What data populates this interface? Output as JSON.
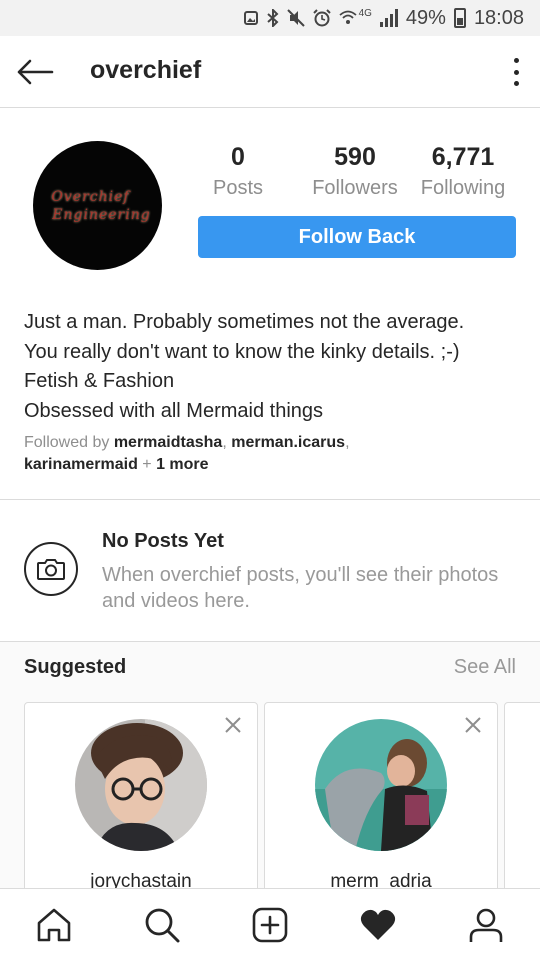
{
  "status_bar": {
    "network": "4G",
    "battery": "49%",
    "time": "18:08"
  },
  "header": {
    "back_icon": "arrow-left-icon",
    "username": "overchief",
    "menu_icon": "kebab-menu-icon"
  },
  "profile": {
    "avatar_text_line1": "Overchief",
    "avatar_text_line2": "Engineering",
    "stats": {
      "posts_count": "0",
      "posts_label": "Posts",
      "followers_count": "590",
      "followers_label": "Followers",
      "following_count": "6,771",
      "following_label": "Following"
    },
    "follow_button_label": "Follow Back",
    "bio_lines": [
      "Just a man. Probably sometimes not the average.",
      "You really don't want to know the kinky details. ;-)",
      "Fetish & Fashion",
      "Obsessed with all Mermaid things"
    ],
    "followed_by": {
      "prefix": "Followed by ",
      "user1": "mermaidtasha",
      "sep1": ", ",
      "user2": "merman.icarus",
      "sep2": ",",
      "user3": "karinamermaid",
      "more_sep": " + ",
      "more": "1 more"
    }
  },
  "no_posts": {
    "title": "No Posts Yet",
    "text": "When overchief posts, you'll see their photos and videos here."
  },
  "suggested": {
    "title": "Suggested",
    "see_all": "See All",
    "cards": [
      {
        "username": "jorychastain"
      },
      {
        "username": "merm_adria"
      }
    ]
  },
  "bottom_nav": [
    {
      "icon": "home-icon"
    },
    {
      "icon": "search-icon"
    },
    {
      "icon": "add-post-icon"
    },
    {
      "icon": "heart-icon"
    },
    {
      "icon": "profile-icon"
    }
  ],
  "colors": {
    "accent": "#3897f0",
    "text": "#262626",
    "muted": "#8e8e8e",
    "border": "#dbdbdb"
  }
}
